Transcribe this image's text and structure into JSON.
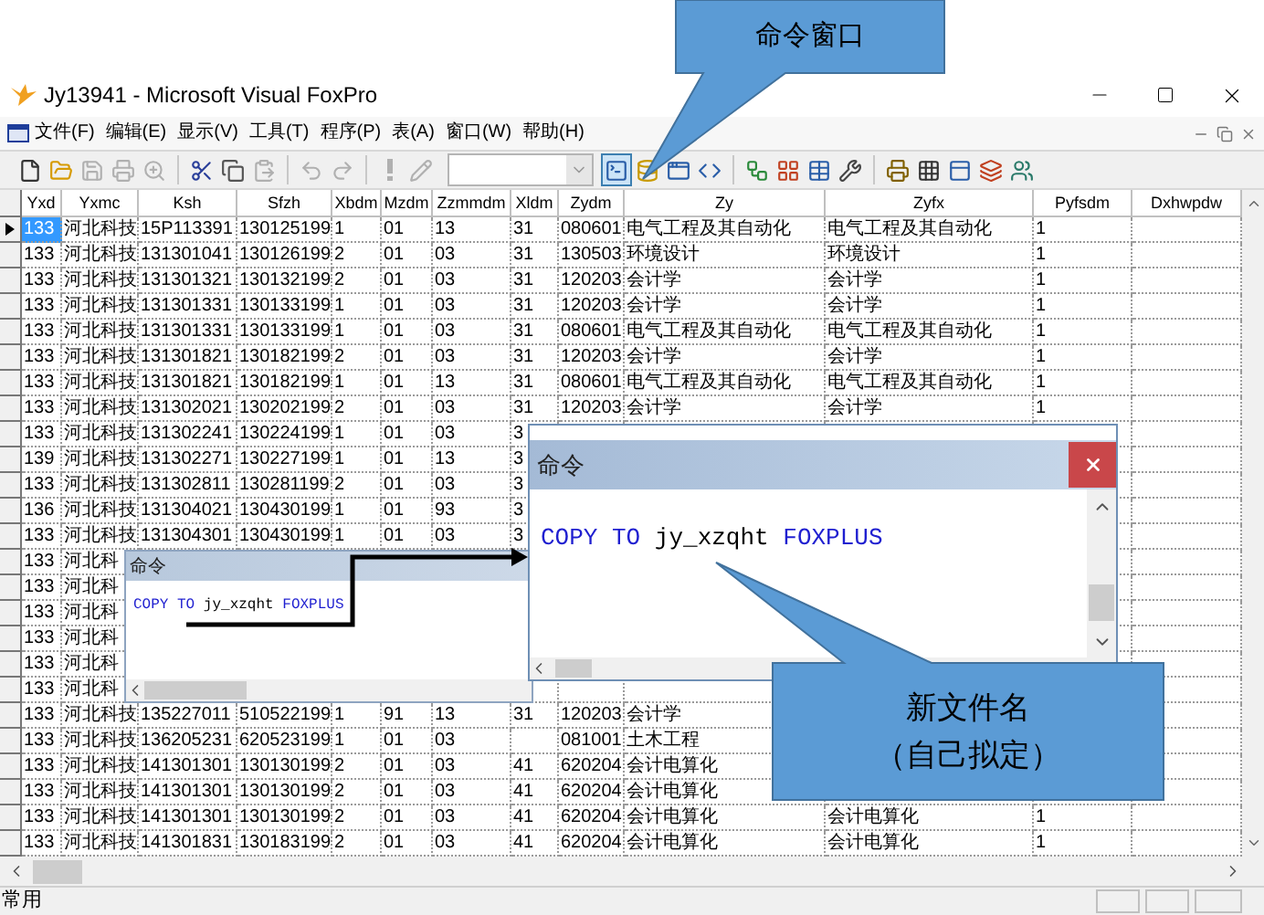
{
  "callouts": [
    {
      "kind": "top",
      "lines": [
        "命令窗口"
      ]
    },
    {
      "kind": "bottom",
      "lines": [
        "新文件名",
        "（自己拟定）"
      ]
    }
  ],
  "window": {
    "title": "Jy13941 - Microsoft Visual FoxPro"
  },
  "menu": [
    "文件(F)",
    "编辑(E)",
    "显示(V)",
    "工具(T)",
    "程序(P)",
    "表(A)",
    "窗口(W)",
    "帮助(H)"
  ],
  "toolbar": {
    "buttons": [
      {
        "disabled": false,
        "pressed": false
      },
      {
        "disabled": false,
        "pressed": false
      },
      {
        "disabled": true,
        "pressed": false
      },
      {
        "disabled": true,
        "pressed": false
      },
      {
        "disabled": true,
        "pressed": false
      },
      {
        "disabled": false,
        "pressed": false
      },
      {
        "disabled": false,
        "pressed": false
      },
      {
        "disabled": true,
        "pressed": false
      },
      {
        "disabled": true,
        "pressed": false
      },
      {
        "disabled": true,
        "pressed": false
      },
      {
        "disabled": true,
        "pressed": false
      },
      {
        "disabled": true,
        "pressed": false
      },
      {
        "disabled": false,
        "pressed": true
      },
      {
        "disabled": false,
        "pressed": false
      },
      {
        "disabled": false,
        "pressed": false
      },
      {
        "disabled": false,
        "pressed": false
      },
      {
        "disabled": false,
        "pressed": false
      },
      {
        "disabled": false,
        "pressed": false
      },
      {
        "disabled": false,
        "pressed": false
      },
      {
        "disabled": false,
        "pressed": false
      },
      {
        "disabled": false,
        "pressed": false
      },
      {
        "disabled": false,
        "pressed": false
      },
      {
        "disabled": false,
        "pressed": false
      },
      {
        "disabled": false,
        "pressed": false
      },
      {
        "disabled": false,
        "pressed": false
      }
    ]
  },
  "table": {
    "columns": [
      "Yxd",
      "Yxmc",
      "Ksh",
      "Sfzh",
      "Xbdm",
      "Mzdm",
      "Zzmmdm",
      "Xldm",
      "Zydm",
      "Zy",
      "Zyfx",
      "Pyfsdm",
      "Dxhwpdw"
    ],
    "rows": [
      {
        "selected": true,
        "cells": [
          "133",
          "河北科技",
          "15P113391",
          "130125199",
          "1",
          "01",
          "13",
          "31",
          "080601",
          "电气工程及其自动化",
          "电气工程及其自动化",
          "1"
        ]
      },
      {
        "selected": false,
        "cells": [
          "133",
          "河北科技",
          "131301041",
          "130126199",
          "2",
          "01",
          "03",
          "31",
          "130503",
          "环境设计",
          "环境设计",
          "1"
        ]
      },
      {
        "selected": false,
        "cells": [
          "133",
          "河北科技",
          "131301321",
          "130132199",
          "2",
          "01",
          "03",
          "31",
          "120203",
          "会计学",
          "会计学",
          "1"
        ]
      },
      {
        "selected": false,
        "cells": [
          "133",
          "河北科技",
          "131301331",
          "130133199",
          "1",
          "01",
          "03",
          "31",
          "120203",
          "会计学",
          "会计学",
          "1"
        ]
      },
      {
        "selected": false,
        "cells": [
          "133",
          "河北科技",
          "131301331",
          "130133199",
          "1",
          "01",
          "03",
          "31",
          "080601",
          "电气工程及其自动化",
          "电气工程及其自动化",
          "1"
        ]
      },
      {
        "selected": false,
        "cells": [
          "133",
          "河北科技",
          "131301821",
          "130182199",
          "2",
          "01",
          "03",
          "31",
          "120203",
          "会计学",
          "会计学",
          "1"
        ]
      },
      {
        "selected": false,
        "cells": [
          "133",
          "河北科技",
          "131301821",
          "130182199",
          "1",
          "01",
          "13",
          "31",
          "080601",
          "电气工程及其自动化",
          "电气工程及其自动化",
          "1"
        ]
      },
      {
        "selected": false,
        "cells": [
          "133",
          "河北科技",
          "131302021",
          "130202199",
          "2",
          "01",
          "03",
          "31",
          "120203",
          "会计学",
          "会计学",
          "1"
        ]
      },
      {
        "selected": false,
        "cells": [
          "133",
          "河北科技",
          "131302241",
          "130224199",
          "1",
          "01",
          "03",
          "3"
        ]
      },
      {
        "selected": false,
        "cells": [
          "139",
          "河北科技",
          "131302271",
          "130227199",
          "1",
          "01",
          "13",
          "3"
        ]
      },
      {
        "selected": false,
        "cells": [
          "133",
          "河北科技",
          "131302811",
          "130281199",
          "2",
          "01",
          "03",
          "3"
        ]
      },
      {
        "selected": false,
        "cells": [
          "136",
          "河北科技",
          "131304021",
          "130430199",
          "1",
          "01",
          "93",
          "3"
        ]
      },
      {
        "selected": false,
        "cells": [
          "133",
          "河北科技",
          "131304301",
          "130430199",
          "1",
          "01",
          "03",
          "3"
        ]
      },
      {
        "selected": false,
        "cells": [
          "133",
          "河北科"
        ]
      },
      {
        "selected": false,
        "cells": [
          "133",
          "河北科"
        ]
      },
      {
        "selected": false,
        "cells": [
          "133",
          "河北科"
        ]
      },
      {
        "selected": false,
        "cells": [
          "133",
          "河北科"
        ]
      },
      {
        "selected": false,
        "cells": [
          "133",
          "河北科"
        ]
      },
      {
        "selected": false,
        "cells": [
          "133",
          "河北科"
        ]
      },
      {
        "selected": false,
        "cells": [
          "133",
          "河北科技",
          "135227011",
          "510522199",
          "1",
          "91",
          "13",
          "31",
          "120203",
          "会计学"
        ]
      },
      {
        "selected": false,
        "cells": [
          "133",
          "河北科技",
          "136205231",
          "620523199",
          "1",
          "01",
          "03",
          null,
          "081001",
          "土木工程"
        ]
      },
      {
        "selected": false,
        "cells": [
          "133",
          "河北科技",
          "141301301",
          "130130199",
          "2",
          "01",
          "03",
          "41",
          "620204",
          "会计电算化"
        ]
      },
      {
        "selected": false,
        "cells": [
          "133",
          "河北科技",
          "141301301",
          "130130199",
          "2",
          "01",
          "03",
          "41",
          "620204",
          "会计电算化"
        ]
      },
      {
        "selected": false,
        "cells": [
          "133",
          "河北科技",
          "141301301",
          "130130199",
          "2",
          "01",
          "03",
          "41",
          "620204",
          "会计电算化",
          "会计电算化",
          "1"
        ]
      },
      {
        "selected": false,
        "cells": [
          "133",
          "河北科技",
          "141301831",
          "130183199",
          "2",
          "01",
          "03",
          "41",
          "620204",
          "会计电算化",
          "会计电算化",
          "1"
        ]
      }
    ]
  },
  "command_windows": [
    {
      "kind": "small",
      "title": "命令",
      "command": [
        {
          "text": "COPY TO",
          "kind": "keyword"
        },
        {
          "text": "jy_xzqht",
          "kind": "name"
        },
        {
          "text": "FOXPLUS",
          "kind": "keyword"
        }
      ]
    },
    {
      "kind": "large",
      "title": "命令",
      "command": [
        {
          "text": "COPY TO",
          "kind": "keyword"
        },
        {
          "text": "jy_xzqht",
          "kind": "name"
        },
        {
          "text": "FOXPLUS",
          "kind": "keyword"
        }
      ]
    }
  ],
  "status_bar": {
    "text": "常用"
  }
}
